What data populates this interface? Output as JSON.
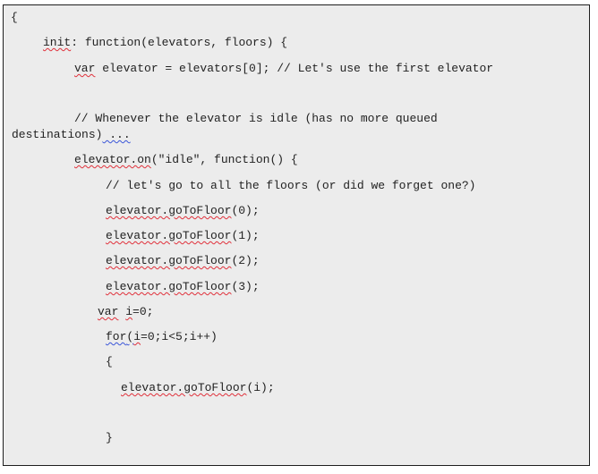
{
  "code": {
    "open_brace": "{",
    "init_kw": "init",
    "init_rest": ": function(elevators, floors) {",
    "var1_kw": "var",
    "var1_rest": " elevator = elevators[0]; // Let's use the first elevator",
    "comment_idle_1": "// Whenever the elevator is idle (has no more queued",
    "comment_idle_2_text": "destinations)",
    "comment_idle_2_tail": " ...",
    "on_call": "elevator.on",
    "on_rest": "(\"idle\", function() {",
    "comment_floors": "// let's go to all the floors (or did we forget one?)",
    "goto_0_call": "elevator.goToFloor",
    "goto_0_arg": "(0);",
    "goto_1_call": "elevator.goToFloor",
    "goto_1_arg": "(1);",
    "goto_2_call": "elevator.goToFloor",
    "goto_2_arg": "(2);",
    "goto_3_call": "elevator.goToFloor",
    "goto_3_arg": "(3);",
    "var2_kw": "var",
    "var2_sp": " ",
    "var2_name": "i",
    "var2_rest": "=0;",
    "for_kw": "for",
    "for_paren": "(",
    "for_i": "i",
    "for_rest": "=0;i<5;i++)",
    "block_open": "{",
    "goto_i_call": "elevator.goToFloor",
    "goto_i_arg": "(i);",
    "block_close": "}"
  }
}
